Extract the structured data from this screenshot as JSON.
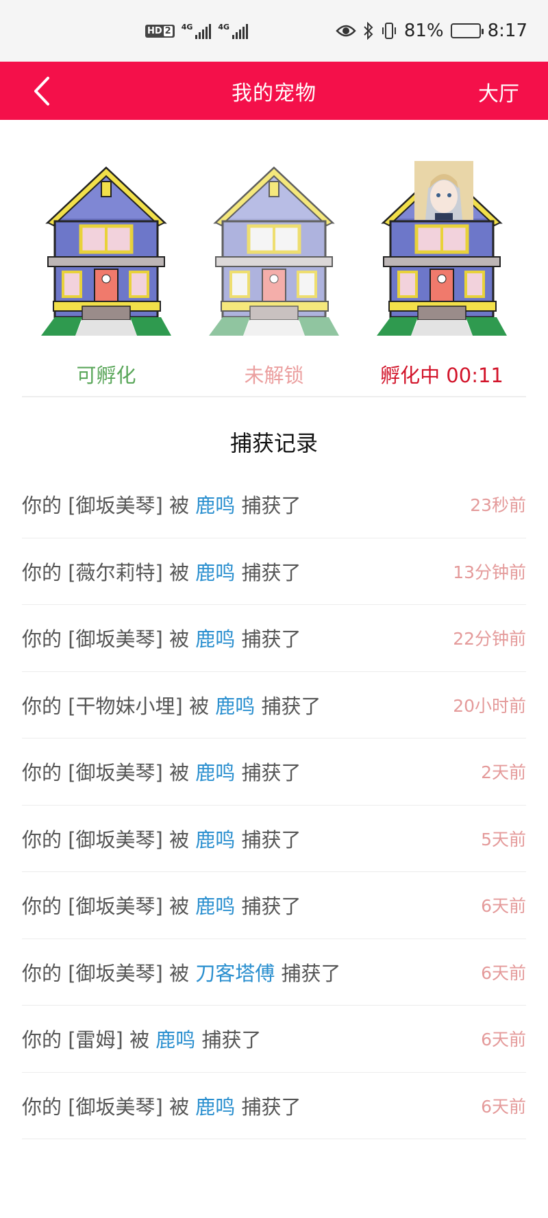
{
  "status_bar": {
    "hd_label": "HD",
    "hd_sub": "2",
    "signal1_label": "4G",
    "signal2_label": "4G",
    "battery_text": "81%",
    "time": "8:17",
    "icons": [
      "eye-icon",
      "bluetooth-icon",
      "vibrate-icon",
      "battery-icon"
    ]
  },
  "header": {
    "title": "我的宠物",
    "back_icon": "chevron-left-icon",
    "right_label": "大厅",
    "bg_color": "#f4104a"
  },
  "eggs": [
    {
      "status": "可孵化",
      "state": "ready"
    },
    {
      "status": "未解锁",
      "state": "locked"
    },
    {
      "status": "孵化中 00:11",
      "state": "hatching"
    }
  ],
  "records_title": "捕获记录",
  "records": [
    {
      "prefix": "你的 [御坂美琴] 被",
      "catcher": "鹿鸣",
      "suffix": "捕获了",
      "time": "23秒前"
    },
    {
      "prefix": "你的 [薇尔莉特] 被",
      "catcher": "鹿鸣",
      "suffix": "捕获了",
      "time": "13分钟前"
    },
    {
      "prefix": "你的 [御坂美琴] 被",
      "catcher": "鹿鸣",
      "suffix": "捕获了",
      "time": "22分钟前"
    },
    {
      "prefix": "你的 [干物妹小埋] 被",
      "catcher": "鹿鸣",
      "suffix": "捕获了",
      "time": "20小时前"
    },
    {
      "prefix": "你的 [御坂美琴] 被",
      "catcher": "鹿鸣",
      "suffix": "捕获了",
      "time": "2天前"
    },
    {
      "prefix": "你的 [御坂美琴] 被",
      "catcher": "鹿鸣",
      "suffix": "捕获了",
      "time": "5天前"
    },
    {
      "prefix": "你的 [御坂美琴] 被",
      "catcher": "鹿鸣",
      "suffix": "捕获了",
      "time": "6天前"
    },
    {
      "prefix": "你的 [御坂美琴] 被",
      "catcher": "刀客塔傅",
      "suffix": "捕获了",
      "time": "6天前"
    },
    {
      "prefix": "你的 [雷姆] 被",
      "catcher": "鹿鸣",
      "suffix": "捕获了",
      "time": "6天前"
    },
    {
      "prefix": "你的 [御坂美琴] 被",
      "catcher": "鹿鸣",
      "suffix": "捕获了",
      "time": "6天前"
    }
  ],
  "colors": {
    "catcher": "#2a8fcf",
    "time": "#e49a9a",
    "ready": "#59a659",
    "locked": "#e47b7b",
    "hatching": "#d2142a"
  }
}
